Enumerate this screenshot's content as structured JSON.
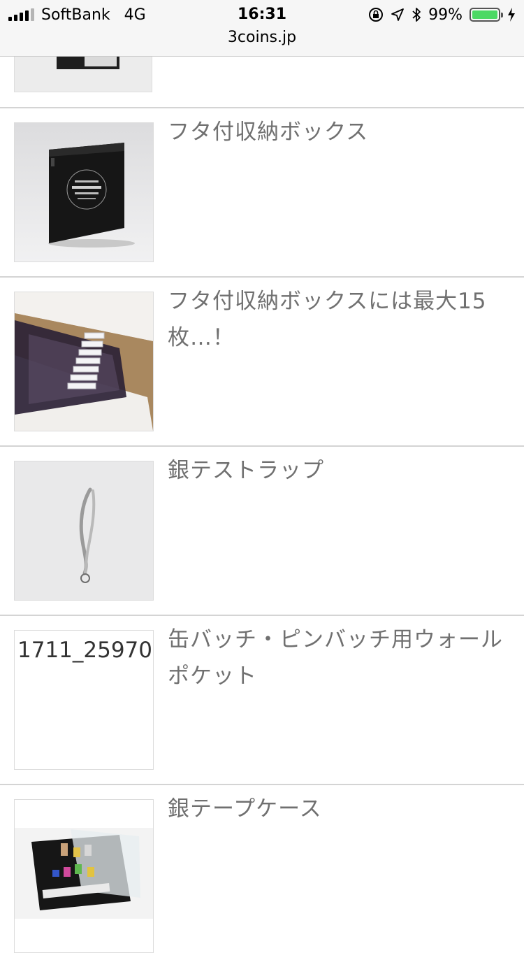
{
  "status_bar": {
    "carrier": "SoftBank",
    "network": "4G",
    "time": "16:31",
    "url": "3coins.jp",
    "battery": "99%",
    "battery_level": 0.99
  },
  "items": [
    {
      "title": "フタ付収納ボックス"
    },
    {
      "title": "フタ付収納ボックスには最大15枚…！"
    },
    {
      "title": "銀テストラップ"
    },
    {
      "title": "缶バッチ・ピンバッチ用ウォールポケット",
      "image_alt": "1711_25970"
    },
    {
      "title": "銀テープケース"
    }
  ],
  "colors": {
    "title_text": "#707070",
    "separator": "#d4d4d4",
    "battery_fill": "#4cd964"
  }
}
